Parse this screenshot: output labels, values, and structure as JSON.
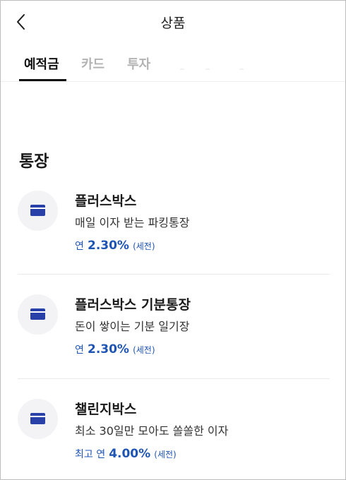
{
  "header": {
    "title": "상품",
    "back_icon": "chevron-left-icon"
  },
  "tabs": [
    {
      "label": "예적금",
      "active": true
    },
    {
      "label": "카드",
      "active": false
    },
    {
      "label": "투자",
      "active": false
    }
  ],
  "section": {
    "title": "통장"
  },
  "products": [
    {
      "name": "플러스박스",
      "description": "매일 이자 받는 파킹통장",
      "rate_prefix": "연",
      "rate_value": "2.30%",
      "rate_note": "(세전)",
      "icon": "card-icon"
    },
    {
      "name": "플러스박스 기분통장",
      "description": "돈이 쌓이는 기분 일기장",
      "rate_prefix": "연",
      "rate_value": "2.30%",
      "rate_note": "(세전)",
      "icon": "card-icon"
    },
    {
      "name": "챌린지박스",
      "description": "최소 30일만 모아도 쏠쏠한 이자",
      "rate_prefix": "최고 연",
      "rate_value": "4.00%",
      "rate_note": "(세전)",
      "icon": "card-icon"
    }
  ],
  "colors": {
    "accent_blue": "#1e55b5",
    "icon_blue": "#2840a8",
    "icon_bg": "#f3f3f5",
    "inactive_tab": "#b3b3b3"
  }
}
